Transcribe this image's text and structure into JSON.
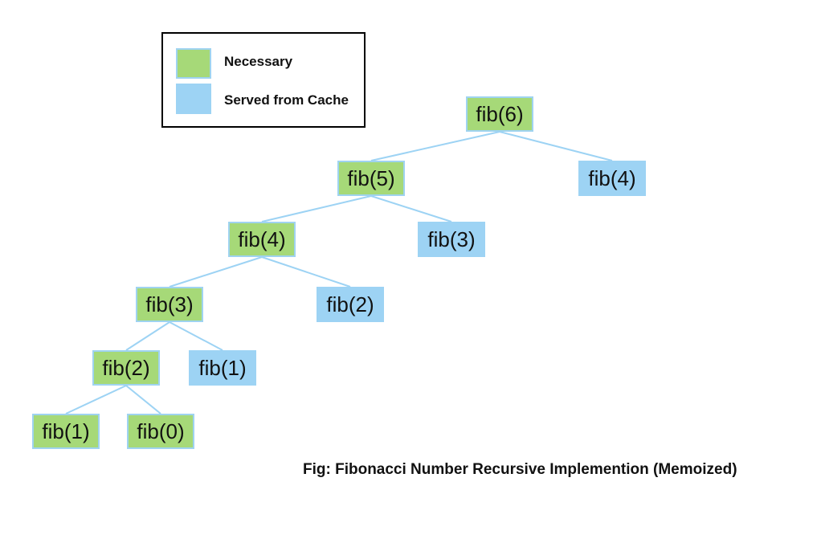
{
  "legend": {
    "items": [
      {
        "label": "Necessary",
        "color": "#a6d978"
      },
      {
        "label": "Served from Cache",
        "color": "#9dd3f4"
      }
    ]
  },
  "edge_color": "#9dd3f4",
  "nodes": [
    {
      "id": "n6",
      "label": "fib(6)",
      "status": "necessary",
      "parent": null
    },
    {
      "id": "n5",
      "label": "fib(5)",
      "status": "necessary",
      "parent": "n6"
    },
    {
      "id": "n4c",
      "label": "fib(4)",
      "status": "cached",
      "parent": "n6"
    },
    {
      "id": "n4",
      "label": "fib(4)",
      "status": "necessary",
      "parent": "n5"
    },
    {
      "id": "n3c",
      "label": "fib(3)",
      "status": "cached",
      "parent": "n5"
    },
    {
      "id": "n3",
      "label": "fib(3)",
      "status": "necessary",
      "parent": "n4"
    },
    {
      "id": "n2c",
      "label": "fib(2)",
      "status": "cached",
      "parent": "n4"
    },
    {
      "id": "n2",
      "label": "fib(2)",
      "status": "necessary",
      "parent": "n3"
    },
    {
      "id": "n1c",
      "label": "fib(1)",
      "status": "cached",
      "parent": "n3"
    },
    {
      "id": "n1",
      "label": "fib(1)",
      "status": "necessary",
      "parent": "n2"
    },
    {
      "id": "n0",
      "label": "fib(0)",
      "status": "necessary",
      "parent": "n2"
    }
  ],
  "caption": "Fig: Fibonacci Number Recursive Implemention (Memoized)"
}
